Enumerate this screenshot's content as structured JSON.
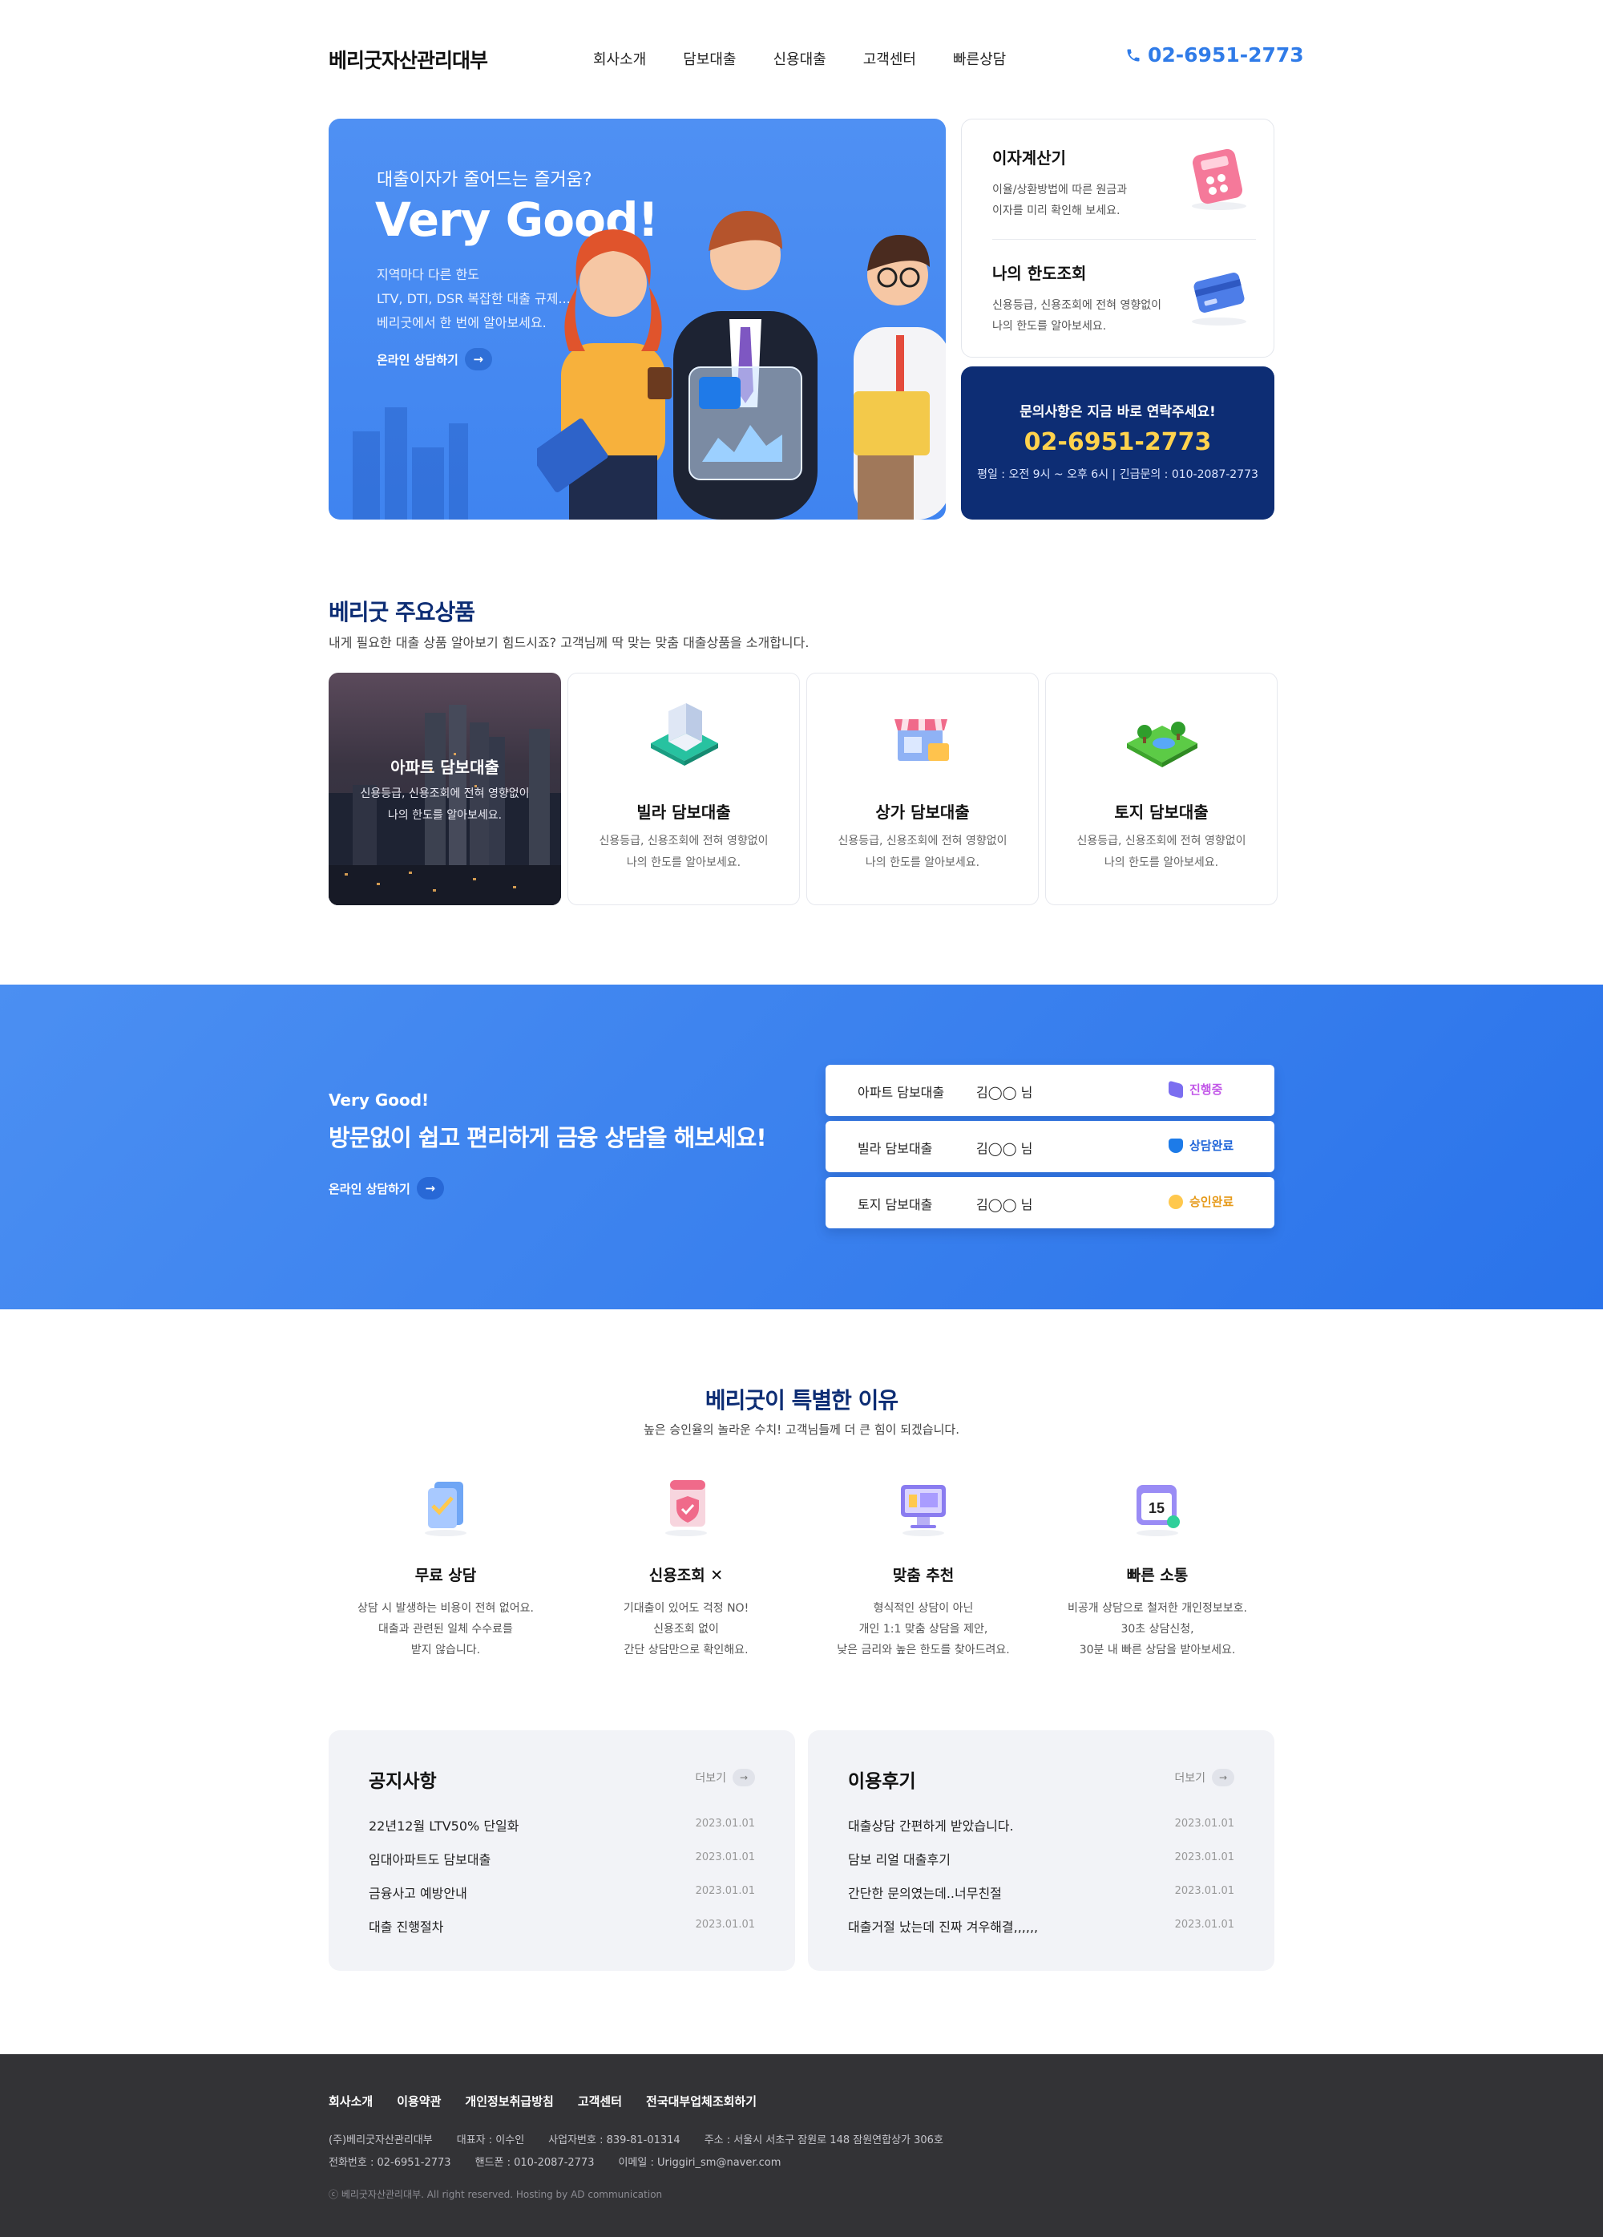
{
  "header": {
    "logo": "베리굿자산관리대부",
    "nav": [
      "회사소개",
      "담보대출",
      "신용대출",
      "고객센터",
      "빠른상담"
    ],
    "phone": "02-6951-2773",
    "phone_icon": "phone-icon"
  },
  "hero": {
    "subtitle": "대출이자가 줄어드는 즐거움?",
    "title": "Very Good!",
    "desc": "지역마다 다른 한도\nLTV, DTI, DSR 복잡한 대출 규제...\n베리굿에서 한 번에 알아보세요.",
    "cta": "온라인 상담하기"
  },
  "side": {
    "calc_title": "이자계산기",
    "calc_desc": "이율/상환방법에 따른 원금과\n이자를 미리 확인해 보세요.",
    "limit_title": "나의 한도조회",
    "limit_desc": "신용등급, 신용조회에 전혀 영향없이\n나의 한도를 알아보세요.",
    "contact_title": "문의사항은 지금 바로 연락주세요!",
    "contact_phone": "02-6951-2773",
    "contact_hours": "평일 : 오전 9시 ~ 오후 6시  |  긴급문의 : 010-2087-2773"
  },
  "products": {
    "title": "베리굿 주요상품",
    "subtitle": "내게 필요한 대출 상품 알아보기 힘드시죠? 고객님께 딱 맞는 맞춤 대출상품을 소개합니다.",
    "items": [
      {
        "name": "아파트 담보대출",
        "desc": "신용등급, 신용조회에 전혀 영향없이\n나의 한도를 알아보세요."
      },
      {
        "name": "빌라 담보대출",
        "desc": "신용등급, 신용조회에 전혀 영향없이\n나의 한도를 알아보세요."
      },
      {
        "name": "상가 담보대출",
        "desc": "신용등급, 신용조회에 전혀 영향없이\n나의 한도를 알아보세요."
      },
      {
        "name": "토지 담보대출",
        "desc": "신용등급, 신용조회에 전혀 영향없이\n나의 한도를 알아보세요."
      }
    ]
  },
  "band": {
    "kicker": "Very Good!",
    "title": "방문없이 쉽고 편리하게 금융 상담을 해보세요!",
    "cta": "온라인 상담하기",
    "rows": [
      {
        "product": "아파트 담보대출",
        "name": "김◯◯ 님",
        "status": "진행중",
        "color": "#c257e8"
      },
      {
        "product": "빌라 담보대출",
        "name": "김◯◯ 님",
        "status": "상담완료",
        "color": "#1d63d8"
      },
      {
        "product": "토지 담보대출",
        "name": "김◯◯ 님",
        "status": "승인완료",
        "color": "#e69a1a"
      }
    ]
  },
  "why": {
    "title": "베리굿이 특별한 이유",
    "subtitle": "높은 승인율의 놀라운 수치! 고객님들께 더 큰 힘이 되겠습니다.",
    "items": [
      {
        "title": "무료 상담",
        "desc": "상담 시 발생하는 비용이 전혀 없어요.\n대출과 관련된 일체 수수료를\n받지 않습니다."
      },
      {
        "title": "신용조회 ✕",
        "desc": "기대출이 있어도 걱정 NO!\n신용조회 없이\n간단 상담만으로 확인해요."
      },
      {
        "title": "맞춤 추천",
        "desc": "형식적인 상담이 아닌\n개인 1:1 맞춤 상담을 제안,\n낮은 금리와 높은 한도를 찾아드려요."
      },
      {
        "title": "빠른 소통",
        "desc": "비공개 상담으로 철저한 개인정보보호.\n30초 상담신청,\n30분 내 빠른 상담을 받아보세요."
      }
    ],
    "calendar_day": "15"
  },
  "notice": {
    "title": "공지사항",
    "more": "더보기",
    "items": [
      {
        "text": "22년12월 LTV50% 단일화",
        "date": "2023.01.01"
      },
      {
        "text": "임대아파트도 담보대출",
        "date": "2023.01.01"
      },
      {
        "text": "금융사고 예방안내",
        "date": "2023.01.01"
      },
      {
        "text": "대출 진행절차",
        "date": "2023.01.01"
      }
    ]
  },
  "review": {
    "title": "이용후기",
    "more": "더보기",
    "items": [
      {
        "text": "대출상담 간편하게 받았습니다.",
        "date": "2023.01.01"
      },
      {
        "text": "담보 리얼 대출후기",
        "date": "2023.01.01"
      },
      {
        "text": "간단한 문의였는데..너무친절",
        "date": "2023.01.01"
      },
      {
        "text": "대출거절 났는데 진짜 겨우해결,,,,,,",
        "date": "2023.01.01"
      }
    ]
  },
  "footer": {
    "nav": [
      "회사소개",
      "이용약관",
      "개인정보취급방침",
      "고객센터",
      "전국대부업체조회하기"
    ],
    "line1": [
      "(주)베리굿자산관리대부",
      "대표자 : 이수인",
      "사업자번호 : 839-81-01314",
      "주소 : 서울시 서초구 잠원로 148 잠원연합상가 306호"
    ],
    "line2": [
      "전화번호 : 02-6951-2773",
      "핸드폰 : 010-2087-2773",
      "이메일 : Uriggiri_sm@naver.com"
    ],
    "copyright": "ⓒ 베리굿자산관리대부. All right reserved. Hosting by AD communication"
  }
}
